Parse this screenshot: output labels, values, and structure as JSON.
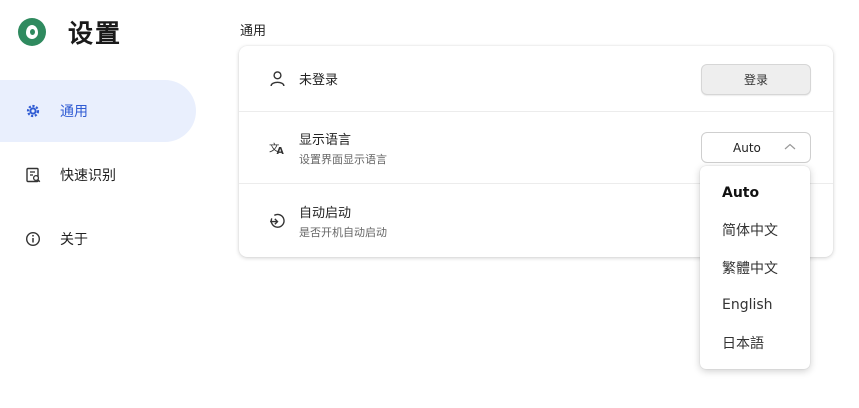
{
  "app": {
    "title": "设置"
  },
  "sidebar": {
    "items": [
      {
        "label": "通用",
        "icon": "gear-icon",
        "active": true
      },
      {
        "label": "快速识别",
        "icon": "recognize-icon",
        "active": false
      },
      {
        "label": "关于",
        "icon": "info-icon",
        "active": false
      }
    ]
  },
  "main": {
    "section_label": "通用",
    "account": {
      "status": "未登录",
      "login_label": "登录"
    },
    "language": {
      "title": "显示语言",
      "subtitle": "设置界面显示语言",
      "selected": "Auto",
      "options": [
        "Auto",
        "简体中文",
        "繁體中文",
        "English",
        "日本語"
      ]
    },
    "autostart": {
      "title": "自动启动",
      "subtitle": "是否开机自动启动"
    }
  },
  "colors": {
    "accent": "#2f5bd3",
    "active_bg": "#e9effd",
    "logo": "#2f8a5f"
  }
}
